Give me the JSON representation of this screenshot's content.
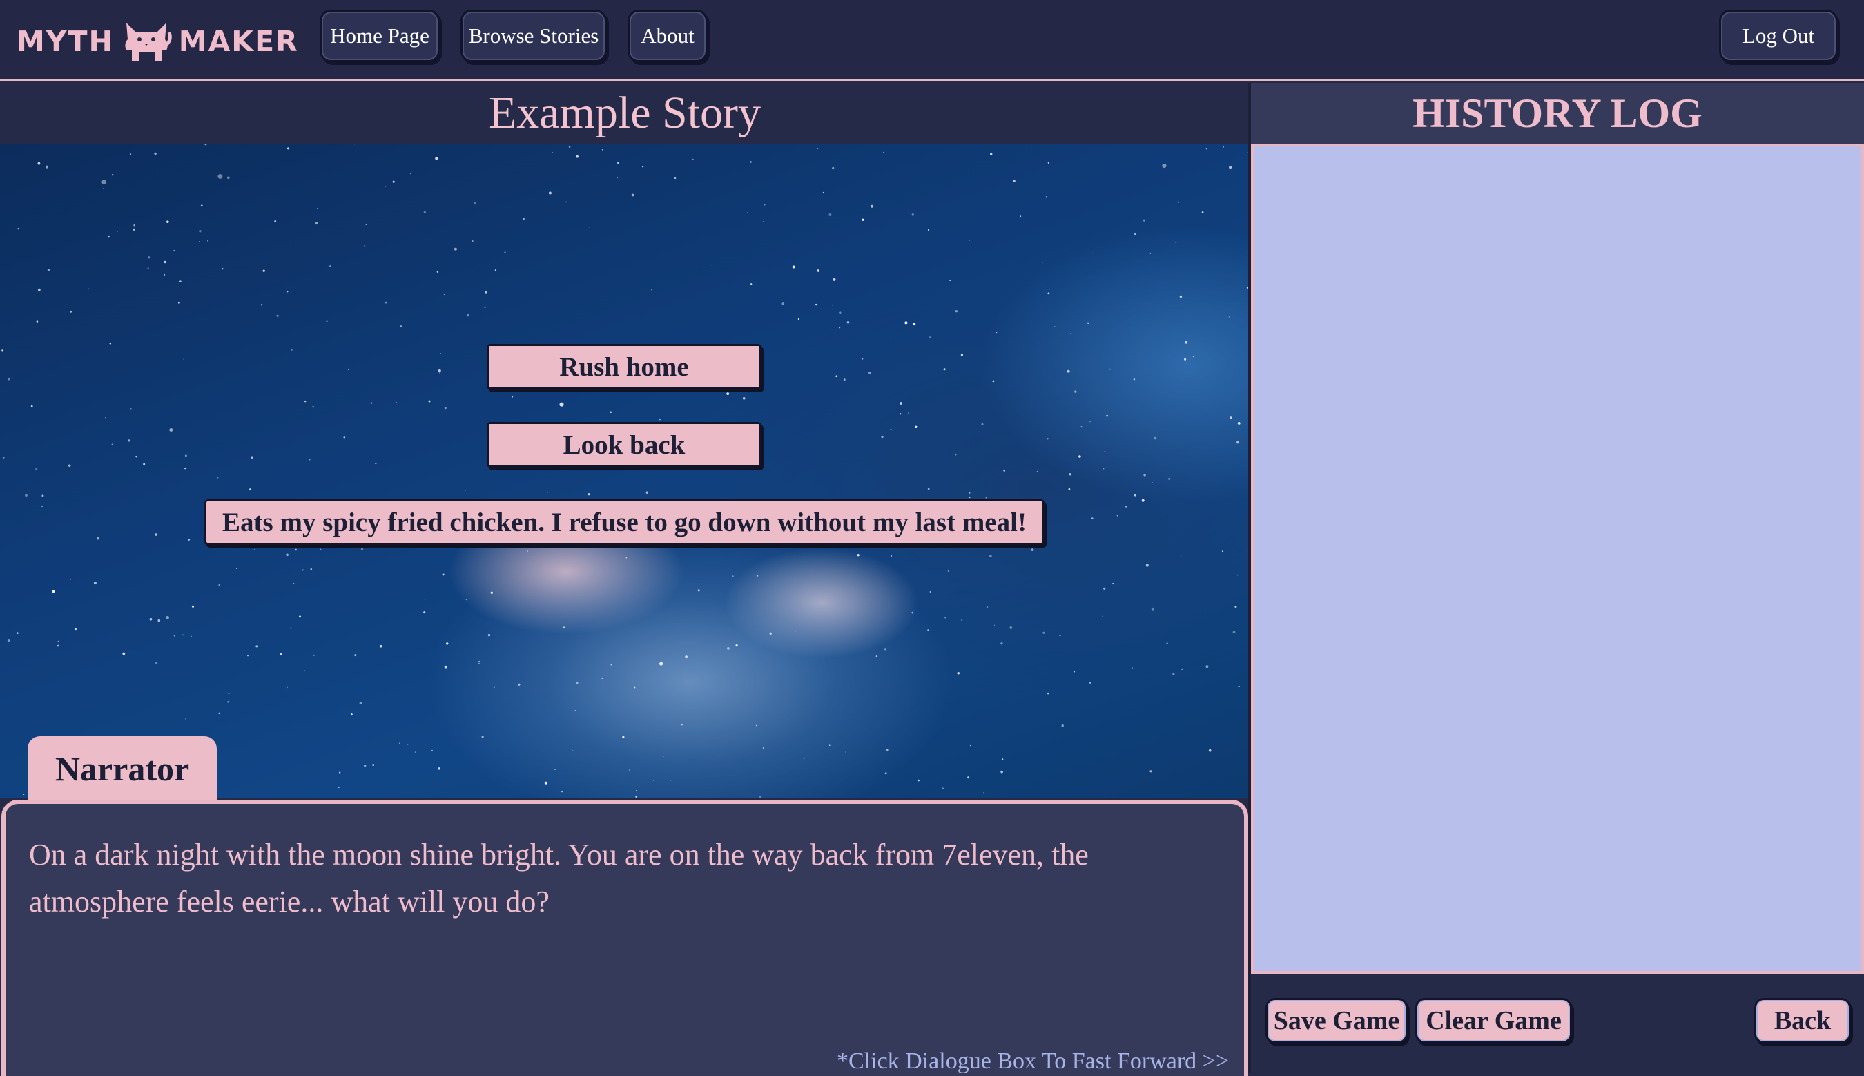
{
  "app": {
    "logo_left": "MYTH",
    "logo_right": "MAKER",
    "logo_icon": "cat-icon"
  },
  "nav": {
    "home": "Home Page",
    "browse": "Browse Stories",
    "about": "About",
    "logout": "Log Out"
  },
  "story": {
    "title": "Example Story",
    "choices": [
      "Rush home",
      "Look back",
      "Eats my spicy fried chicken. I refuse to go down without my last meal!"
    ],
    "speaker": "Narrator",
    "dialogue": "On a dark night with the moon shine bright. You are on the way back from 7eleven, the atmosphere feels eerie... what will you do?",
    "fast_forward_hint": "*Click Dialogue Box To Fast Forward >>"
  },
  "history": {
    "title": "HISTORY LOG",
    "entries": []
  },
  "footer": {
    "save": "Save Game",
    "clear": "Clear Game",
    "back": "Back"
  },
  "colors": {
    "accent_pink": "#ecbcc8",
    "navy": "#252a48",
    "dialogue_bg": "#353a5b",
    "history_bg": "#b8bfea"
  }
}
